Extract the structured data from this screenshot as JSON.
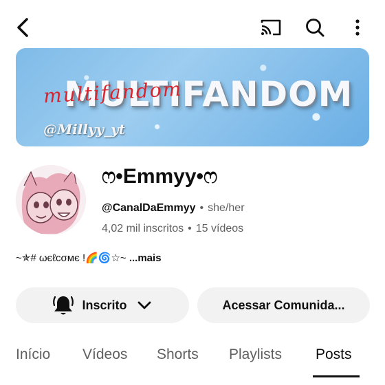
{
  "topbar": {
    "back_icon": "back-arrow-icon",
    "cast_icon": "cast-icon",
    "search_icon": "search-icon",
    "more_icon": "more-vertical-icon"
  },
  "banner": {
    "main_text": "MULTIFANDOM",
    "script_text": "multifandom",
    "handle_text": "@Millyy_yt"
  },
  "channel": {
    "name": "ෆ•Emmyy•ෆ",
    "handle": "@CanalDaEmmyy",
    "pronouns": "she/her",
    "subscribers": "4,02 mil inscritos",
    "videos": "15 vídeos",
    "description": "~✯# ωєℓcσмє !🌈🌀☆~",
    "more_label": "...mais"
  },
  "actions": {
    "subscribed_label": "Inscrito",
    "community_label": "Acessar Comunida..."
  },
  "tabs": [
    {
      "label": "Início"
    },
    {
      "label": "Vídeos"
    },
    {
      "label": "Shorts"
    },
    {
      "label": "Playlists"
    },
    {
      "label": "Posts"
    }
  ],
  "active_tab": "Posts",
  "colors": {
    "text": "#0f0f0f",
    "secondary": "#606060",
    "button_bg": "#f2f2f2",
    "banner_blue": "#7fbbe8",
    "banner_red_script": "#d8242c"
  }
}
